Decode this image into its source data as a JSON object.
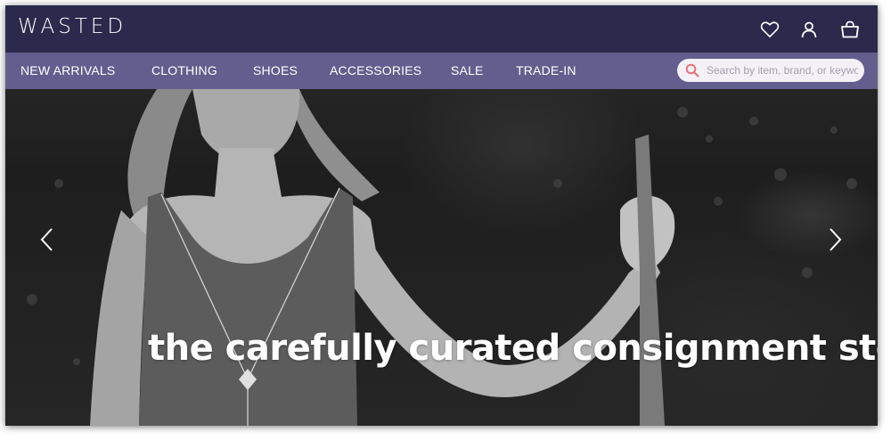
{
  "brand": {
    "logo_text": "WASTED"
  },
  "header_icons": [
    "heart-icon",
    "user-icon",
    "shopping-bag-icon"
  ],
  "nav": {
    "items": [
      {
        "label": "NEW ARRIVALS"
      },
      {
        "label": "CLOTHING"
      },
      {
        "label": "SHOES"
      },
      {
        "label": "ACCESSORIES"
      },
      {
        "label": "SALE"
      },
      {
        "label": "TRADE-IN"
      }
    ]
  },
  "search": {
    "placeholder": "Search by item, brand, or keyword",
    "value": ""
  },
  "hero": {
    "tagline": "the carefully curated consignment store",
    "prev_icon": "chevron-left-icon",
    "next_icon": "chevron-right-icon"
  },
  "colors": {
    "header_bg": "#2b2a4c",
    "nav_bg": "#686396",
    "search_icon": "#e8747c",
    "text": "#ffffff"
  }
}
